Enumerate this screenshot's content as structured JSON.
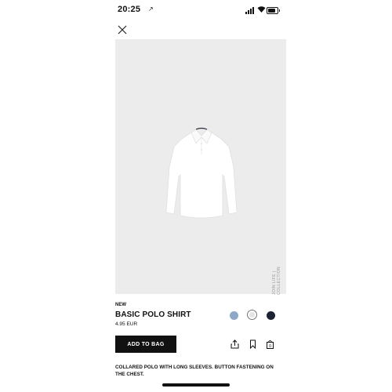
{
  "status_bar": {
    "time": "20:25",
    "location_arrow": "↗"
  },
  "icons": {
    "close": "close-icon",
    "share": "share-icon",
    "bookmark": "bookmark-icon",
    "bag": "bag-icon"
  },
  "product": {
    "badge": "NEW",
    "name": "BASIC POLO SHIRT",
    "price": "4.95 EUR",
    "image_caption": "JOIN LIFE | COLLECTION",
    "description": "COLLARED POLO WITH LONG SLEEVES. BUTTON FASTENING ON THE CHEST."
  },
  "colors": {
    "swatch_blue": "#8fa8c6",
    "swatch_white": "#e4e4e4",
    "swatch_navy": "#1c2333",
    "image_bg": "#ececec"
  },
  "actions": {
    "add_to_bag_label": "ADD TO BAG"
  }
}
